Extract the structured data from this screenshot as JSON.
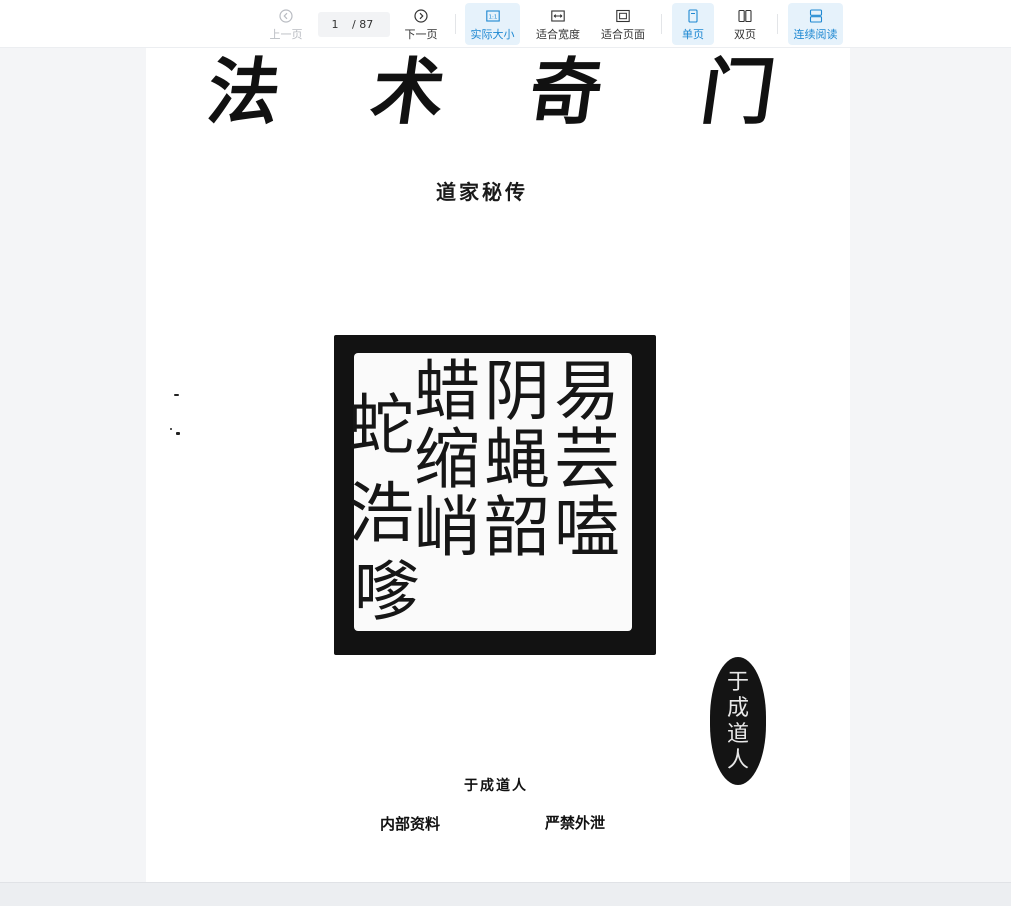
{
  "toolbar": {
    "prev": "上一页",
    "page_current": "1",
    "page_total": "/ 87",
    "next": "下一页",
    "actual_size": "实际大小",
    "actual_size_glyph": "1:1",
    "fit_width": "适合宽度",
    "fit_page": "适合页面",
    "single_page": "单页",
    "double_page": "双页",
    "continuous": "连续阅读",
    "accent": "#1e88d2",
    "active_bg": "#e6f2fb"
  },
  "document": {
    "title_chars": [
      "法",
      "术",
      "奇",
      "门"
    ],
    "subtitle": "道家秘传",
    "seal_chars": [
      "易",
      "阴",
      "蜡",
      "芸",
      "蝇",
      "缩",
      "蛇",
      "嗑",
      "韶",
      "峭",
      "浩",
      "嗲"
    ],
    "oval_seal_chars": [
      "于",
      "成",
      "道",
      "人"
    ],
    "author": "于成道人",
    "note_left": "内部资料",
    "note_right": "严禁外泄"
  }
}
